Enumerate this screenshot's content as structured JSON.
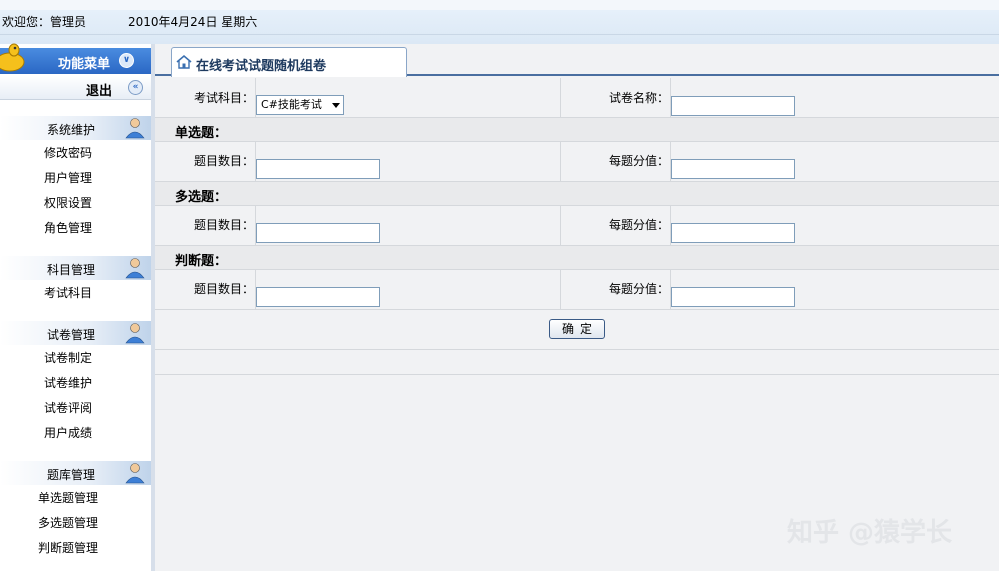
{
  "topbar": {
    "welcome": "欢迎您：管理员",
    "date": "2010年4月24日  星期六"
  },
  "sidebar": {
    "menu_title": "功能菜单",
    "exit_label": "退出",
    "groups": [
      {
        "title": "系统维护",
        "items": [
          "修改密码",
          "用户管理",
          "权限设置",
          "角色管理"
        ]
      },
      {
        "title": "科目管理",
        "items": [
          "考试科目"
        ]
      },
      {
        "title": "试卷管理",
        "items": [
          "试卷制定",
          "试卷维护",
          "试卷评阅",
          "用户成绩"
        ]
      },
      {
        "title": "题库管理",
        "items": [
          "单选题管理",
          "多选题管理",
          "判断题管理"
        ]
      }
    ]
  },
  "main": {
    "tab_title": "在线考试试题随机组卷",
    "subject_label": "考试科目：",
    "subject_selected": "C#技能考试",
    "paper_name_label": "试卷名称：",
    "paper_name_value": "",
    "sections": [
      {
        "title": "单选题：",
        "count_label": "题目数目：",
        "score_label": "每题分值："
      },
      {
        "title": "多选题：",
        "count_label": "题目数目：",
        "score_label": "每题分值："
      },
      {
        "title": "判断题：",
        "count_label": "题目数目：",
        "score_label": "每题分值："
      }
    ],
    "confirm_button": "确定"
  },
  "watermark": "知乎 @猿学长",
  "colors": {
    "menu_header": "#2a67c4",
    "tab_border": "#4a6fa0",
    "content_bg": "#f1f2f4"
  }
}
